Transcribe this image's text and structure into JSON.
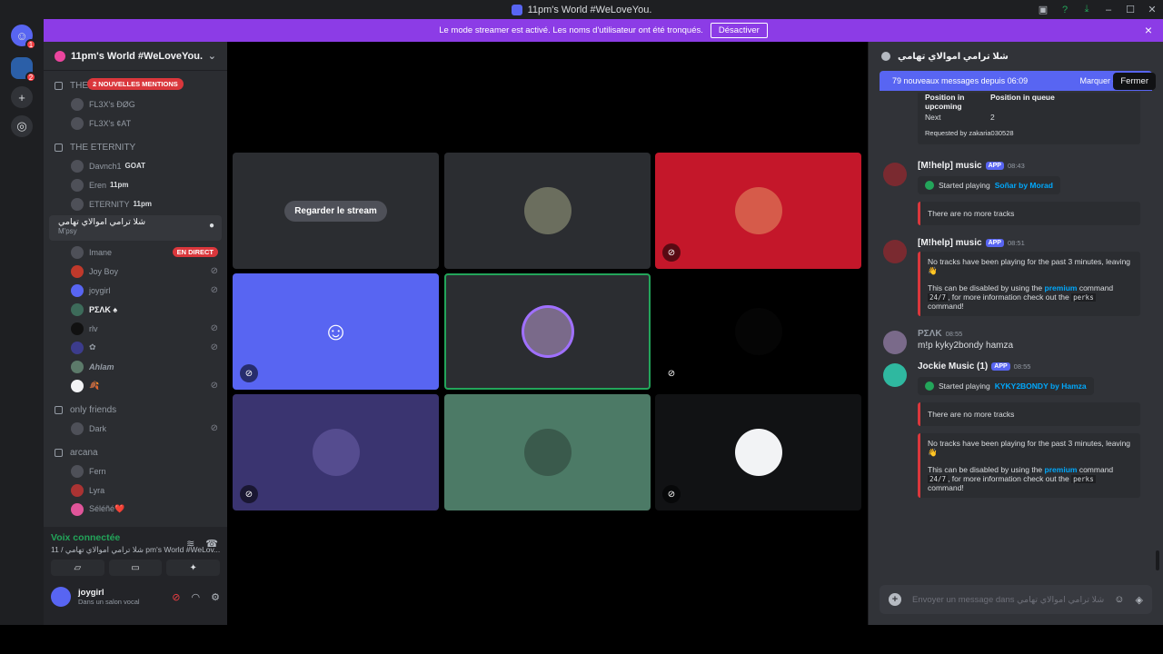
{
  "window": {
    "title": "11pm's World #WeLoveYou."
  },
  "banner": {
    "text": "Le mode streamer est activé. Les noms d'utilisateur ont été tronqués.",
    "button": "Désactiver"
  },
  "servers": [
    {
      "badge": "1"
    },
    {
      "badge": "2"
    }
  ],
  "guild": {
    "name": "11pm's World #WeLoveYou.",
    "mentions": "2 NOUVELLES MENTIONS"
  },
  "categories": {
    "c1": "THE NEXT",
    "c2": "THE ETERNITY",
    "c3": "only friends",
    "c4": "arcana"
  },
  "users1": [
    "FL3X's ÐØG",
    "FL3X's ¢AT"
  ],
  "users2": [
    {
      "name": "Davnch1",
      "tag": "GOAT"
    },
    {
      "name": "Eren",
      "tag": "11pm"
    },
    {
      "name": "ETERNITY",
      "tag": "11pm"
    }
  ],
  "voice_channel": {
    "name": "شلا ترامي اموالاي تهامي",
    "sub": "M'psy"
  },
  "voice_users": [
    {
      "name": "Imane",
      "live": "EN DIRECT"
    },
    {
      "name": "Joy Boy"
    },
    {
      "name": "joygirl"
    },
    {
      "name": "PΣΛK ♠"
    },
    {
      "name": "rlv"
    },
    {
      "name": "✿"
    },
    {
      "name": "Ahlam"
    },
    {
      "name": "🍂"
    }
  ],
  "users3": [
    "Dark"
  ],
  "users4": [
    "Fern",
    "Lyra",
    "Séléñé❤️"
  ],
  "voicepanel": {
    "title": "Voix connectée",
    "sub": "11 / شلا ترامي اموالاي تهامي pm's World #WeLov...",
    "user": "joygirl",
    "status": "Dans un salon vocal"
  },
  "stage": {
    "watch_label": "Regarder le stream"
  },
  "chat": {
    "channel": "شلا ترامي اموالاي تهامي",
    "newmsgs": "79 nouveaux messages depuis 06:09",
    "mark": "Marquer comme",
    "tooltip": "Fermer",
    "queue": {
      "k1": "Position in upcoming",
      "v1": "Next",
      "k2": "Position in queue",
      "v2": "2",
      "req": "Requested by zakaria030528"
    },
    "m1": {
      "name": "[M!help] music",
      "app": "APP",
      "time": "08:43",
      "text": "Started playing",
      "link": "Soñar by Morad",
      "card": "There are no more tracks"
    },
    "m2": {
      "name": "[M!help] music",
      "app": "APP",
      "time": "08:51",
      "l1": "No tracks have been playing for the past 3 minutes, leaving 👋",
      "l2a": "This can be disabled by using the",
      "premium": "premium",
      "l2b": "command",
      "code1": "24/7",
      "l2c": ", for more information check out the",
      "code2": "perks",
      "l2d": "command!"
    },
    "m3": {
      "name": "PΣΛK",
      "time": "08:55",
      "text": "m!p kyky2bondy hamza"
    },
    "m4": {
      "name": "Jockie Music (1)",
      "app": "APP",
      "time": "08:55",
      "text": "Started playing",
      "link": "KYKY2BONDY by Hamza",
      "card": "There are no more tracks"
    },
    "m5": {
      "l1": "No tracks have been playing for the past 3 minutes, leaving 👋",
      "l2a": "This can be disabled by using the",
      "premium": "premium",
      "l2b": "command",
      "code1": "24/7",
      "l2c": ", for more information check out the",
      "code2": "perks",
      "l2d": "command!"
    },
    "composer": "Envoyer un message dans شلا ترامي اموالاي تهامي"
  }
}
